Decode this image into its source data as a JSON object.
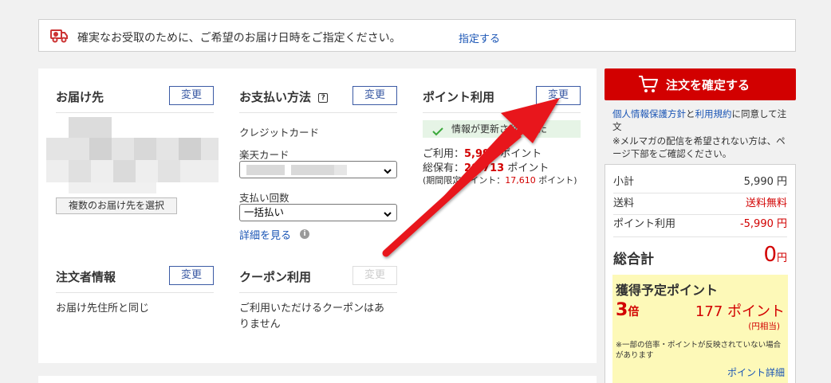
{
  "notice": {
    "message": "確実なお受取のために、ご希望のお届け日時をご指定ください。",
    "link": "指定する"
  },
  "delivery": {
    "title": "お届け先",
    "change": "変更",
    "multi_button": "複数のお届け先を選択"
  },
  "payment": {
    "title": "お支払い方法",
    "help_icon": "?",
    "change": "変更",
    "method": "クレジットカード",
    "card_label": "楽天カード",
    "installments_label": "支払い回数",
    "installments_value": "一括払い",
    "detail_link": "詳細を見る"
  },
  "points": {
    "title": "ポイント利用",
    "change": "変更",
    "updated": "情報が更新されました",
    "use_label": "ご利用：",
    "use_value": "5,990",
    "use_unit": " ポイント",
    "hold_label": "総保有：",
    "hold_value": "20,713",
    "hold_unit": " ポイント",
    "limited_label": "(期間限定ポイント：",
    "limited_value": "17,610",
    "limited_unit": " ポイント)"
  },
  "orderer": {
    "title": "注文者情報",
    "change": "変更",
    "text": "お届け先住所と同じ"
  },
  "coupon": {
    "title": "クーポン利用",
    "change": "変更",
    "text_line1": "ご利用いただけるクーポンはあ",
    "text_line2": "りません"
  },
  "sidebar": {
    "confirm": "注文を確定する",
    "privacy_link": "個人情報保護方針",
    "and": "と",
    "terms_link": "利用規約",
    "agree_text": "に同意して注文",
    "mail_note": "※メルマガの配信を希望されない方は、ページ下部をご確認ください。"
  },
  "summary": {
    "subtotal_label": "小計",
    "subtotal_value": "5,990 円",
    "shipping_label": "送料",
    "shipping_value": "送料無料",
    "points_label": "ポイント利用",
    "points_value": "-5,990 円",
    "total_label": "総合計",
    "total_value": "0",
    "total_unit": "円"
  },
  "earn": {
    "title": "獲得予定ポイント",
    "multiplier": "3",
    "multiplier_unit": "倍",
    "points": "177 ポイント",
    "yen_equiv": "(円相当)",
    "note": "※一部の倍率・ポイントが反映されていない場合があります",
    "detail_link": "ポイント詳細"
  },
  "colors": {
    "accent_red": "#d20000",
    "link_blue": "#1a55b5",
    "button_blue": "#3b5aa4",
    "highlight_yellow": "#fdf9b8"
  }
}
